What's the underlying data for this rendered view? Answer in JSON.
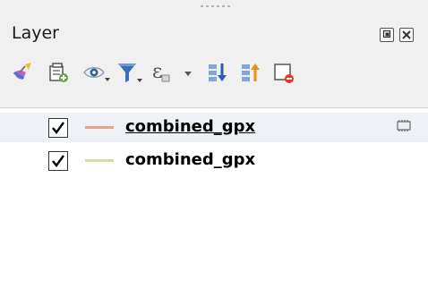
{
  "panel": {
    "title": "Layer"
  },
  "toolbar": {
    "icons": [
      "style-paintbrush-icon",
      "add-group-icon",
      "manage-visibility-icon",
      "filter-legend-icon",
      "filter-by-expression-icon",
      "expand-all-icon",
      "collapse-all-icon",
      "remove-layer-icon"
    ]
  },
  "layers": [
    {
      "name": "combined_gpx",
      "checked": true,
      "symbol_color": "#e8a28a",
      "selected": true
    },
    {
      "name": "combined_gpx",
      "checked": true,
      "symbol_color": "#cfe0a0",
      "selected": false
    }
  ],
  "colors": {
    "panel_bg": "#f0f0f0",
    "tree_bg": "#ffffff",
    "selected_row": "#eef1f5"
  }
}
